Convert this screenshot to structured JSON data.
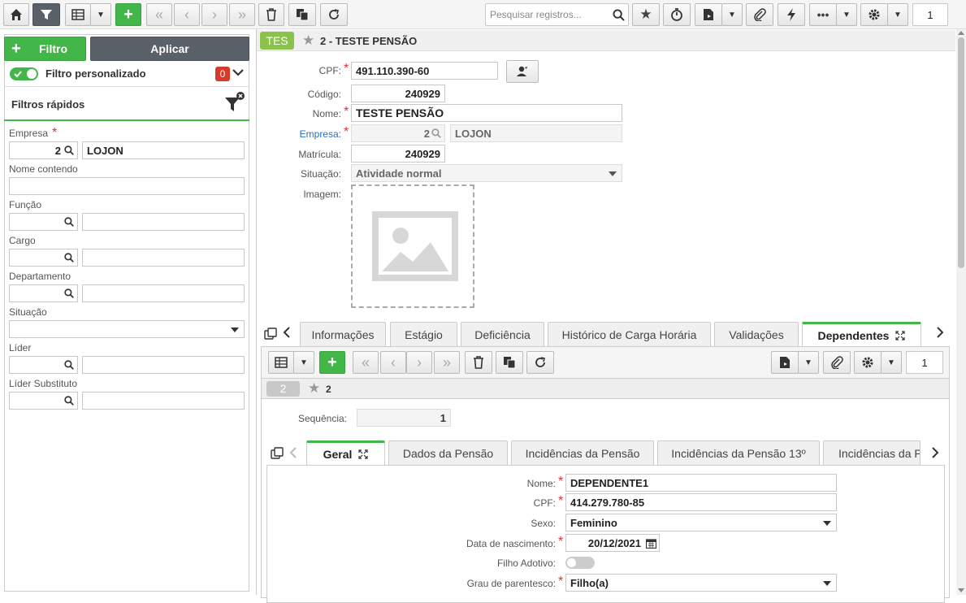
{
  "toolbar": {
    "search_placeholder": "Pesquisar registros...",
    "page_number": "1"
  },
  "filter_panel": {
    "filter_button": "Filtro",
    "apply_button": "Aplicar",
    "custom_filter_label": "Filtro personalizado",
    "custom_filter_count": "0",
    "quick_filters_title": "Filtros rápidos",
    "empresa_label": "Empresa",
    "empresa_code": "2",
    "empresa_name": "LOJON",
    "nome_label": "Nome contendo",
    "funcao_label": "Função",
    "cargo_label": "Cargo",
    "departamento_label": "Departamento",
    "situacao_label": "Situação",
    "lider_label": "Líder",
    "lider_substituto_label": "Líder Substituto"
  },
  "record": {
    "badge": "TES",
    "title": "2 - TESTE PENSÃO",
    "cpf_label": "CPF:",
    "cpf_value": "491.110.390-60",
    "codigo_label": "Código:",
    "codigo_value": "240929",
    "nome_label": "Nome:",
    "nome_value": "TESTE PENSÃO",
    "empresa_label": "Empresa:",
    "empresa_code": "2",
    "empresa_name": "LOJON",
    "matricula_label": "Matrícula:",
    "matricula_value": "240929",
    "situacao_label": "Situação:",
    "situacao_value": "Atividade normal",
    "imagem_label": "Imagem:"
  },
  "main_tabs": [
    "Informações",
    "Estágio",
    "Deficiência",
    "Histórico de Carga Horária",
    "Validações",
    "Dependentes"
  ],
  "dependent": {
    "page_number": "1",
    "badge": "2",
    "title": "2",
    "sequencia_label": "Sequência:",
    "sequencia_value": "1",
    "tabs": [
      "Geral",
      "Dados da Pensão",
      "Incidências da Pensão",
      "Incidências da Pensão 13º",
      "Incidências da P"
    ],
    "nome_label": "Nome:",
    "nome_value": "DEPENDENTE1",
    "cpf_label": "CPF:",
    "cpf_value": "414.279.780-85",
    "sexo_label": "Sexo:",
    "sexo_value": "Feminino",
    "nascimento_label": "Data de nascimento:",
    "nascimento_value": "20/12/2021",
    "adotivo_label": "Filho Adotivo:",
    "parentesco_label": "Grau de parentesco:",
    "parentesco_value": "Filho(a)"
  },
  "colors": {
    "accent_green": "#43b649",
    "dark_button": "#5a6068",
    "badge_red": "#d9392b",
    "link_blue": "#2a6ebb"
  }
}
